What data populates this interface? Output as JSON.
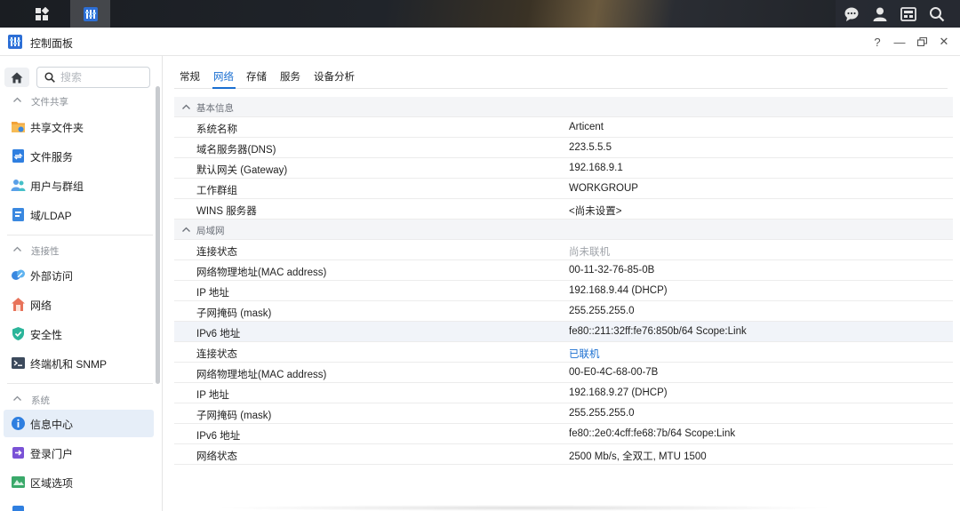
{
  "window": {
    "title": "控制面板"
  },
  "titlebar_controls": {
    "help": "?",
    "minimize": "—",
    "restore": "▭",
    "close": "✕"
  },
  "sidebar": {
    "search_placeholder": "搜索",
    "sections": [
      {
        "label": "文件共享",
        "items": [
          {
            "label": "共享文件夹",
            "icon": "shared-folder-icon"
          },
          {
            "label": "文件服务",
            "icon": "file-services-icon"
          },
          {
            "label": "用户与群组",
            "icon": "users-groups-icon"
          },
          {
            "label": "域/LDAP",
            "icon": "domain-ldap-icon"
          }
        ]
      },
      {
        "label": "连接性",
        "items": [
          {
            "label": "外部访问",
            "icon": "external-access-icon"
          },
          {
            "label": "网络",
            "icon": "network-icon"
          },
          {
            "label": "安全性",
            "icon": "security-shield-icon"
          },
          {
            "label": "终端机和 SNMP",
            "icon": "terminal-icon"
          }
        ]
      },
      {
        "label": "系统",
        "items": [
          {
            "label": "信息中心",
            "icon": "info-center-icon",
            "active": true
          },
          {
            "label": "登录门户",
            "icon": "login-portal-icon"
          },
          {
            "label": "区域选项",
            "icon": "regional-options-icon"
          }
        ]
      }
    ]
  },
  "tabs": [
    "常规",
    "网络",
    "存储",
    "服务",
    "设备分析"
  ],
  "active_tab": "网络",
  "groups": {
    "basic": {
      "label": "基本信息",
      "rows": [
        {
          "key": "系统名称",
          "value": "Articent"
        },
        {
          "key": "域名服务器(DNS)",
          "value": "223.5.5.5"
        },
        {
          "key": "默认网关 (Gateway)",
          "value": "192.168.9.1"
        },
        {
          "key": "工作群组",
          "value": "WORKGROUP"
        },
        {
          "key": "WINS 服务器",
          "value": "<尚未设置>"
        }
      ]
    },
    "lan": {
      "label": "局域网",
      "rows": [
        {
          "key": "连接状态",
          "value": "尚未联机"
        },
        {
          "key": "网络物理地址(MAC address)",
          "value": "00-11-32-76-85-0B"
        },
        {
          "key": "IP 地址",
          "value": "192.168.9.44 (DHCP)"
        },
        {
          "key": "子网掩码 (mask)",
          "value": "255.255.255.0"
        },
        {
          "key": "IPv6 地址",
          "value": "fe80::211:32ff:fe76:850b/64 Scope:Link"
        },
        {
          "key": "连接状态",
          "value": "已联机"
        },
        {
          "key": "网络物理地址(MAC address)",
          "value": "00-E0-4C-68-00-7B"
        },
        {
          "key": "IP 地址",
          "value": "192.168.9.27 (DHCP)"
        },
        {
          "key": "子网掩码 (mask)",
          "value": "255.255.255.0"
        },
        {
          "key": "IPv6 地址",
          "value": "fe80::2e0:4cff:fe68:7b/64 Scope:Link"
        },
        {
          "key": "网络状态",
          "value": "2500 Mb/s, 全双工, MTU 1500"
        }
      ]
    }
  },
  "colors": {
    "accent": "#1a6fd1",
    "active_nav_bg": "#e6eef8"
  }
}
